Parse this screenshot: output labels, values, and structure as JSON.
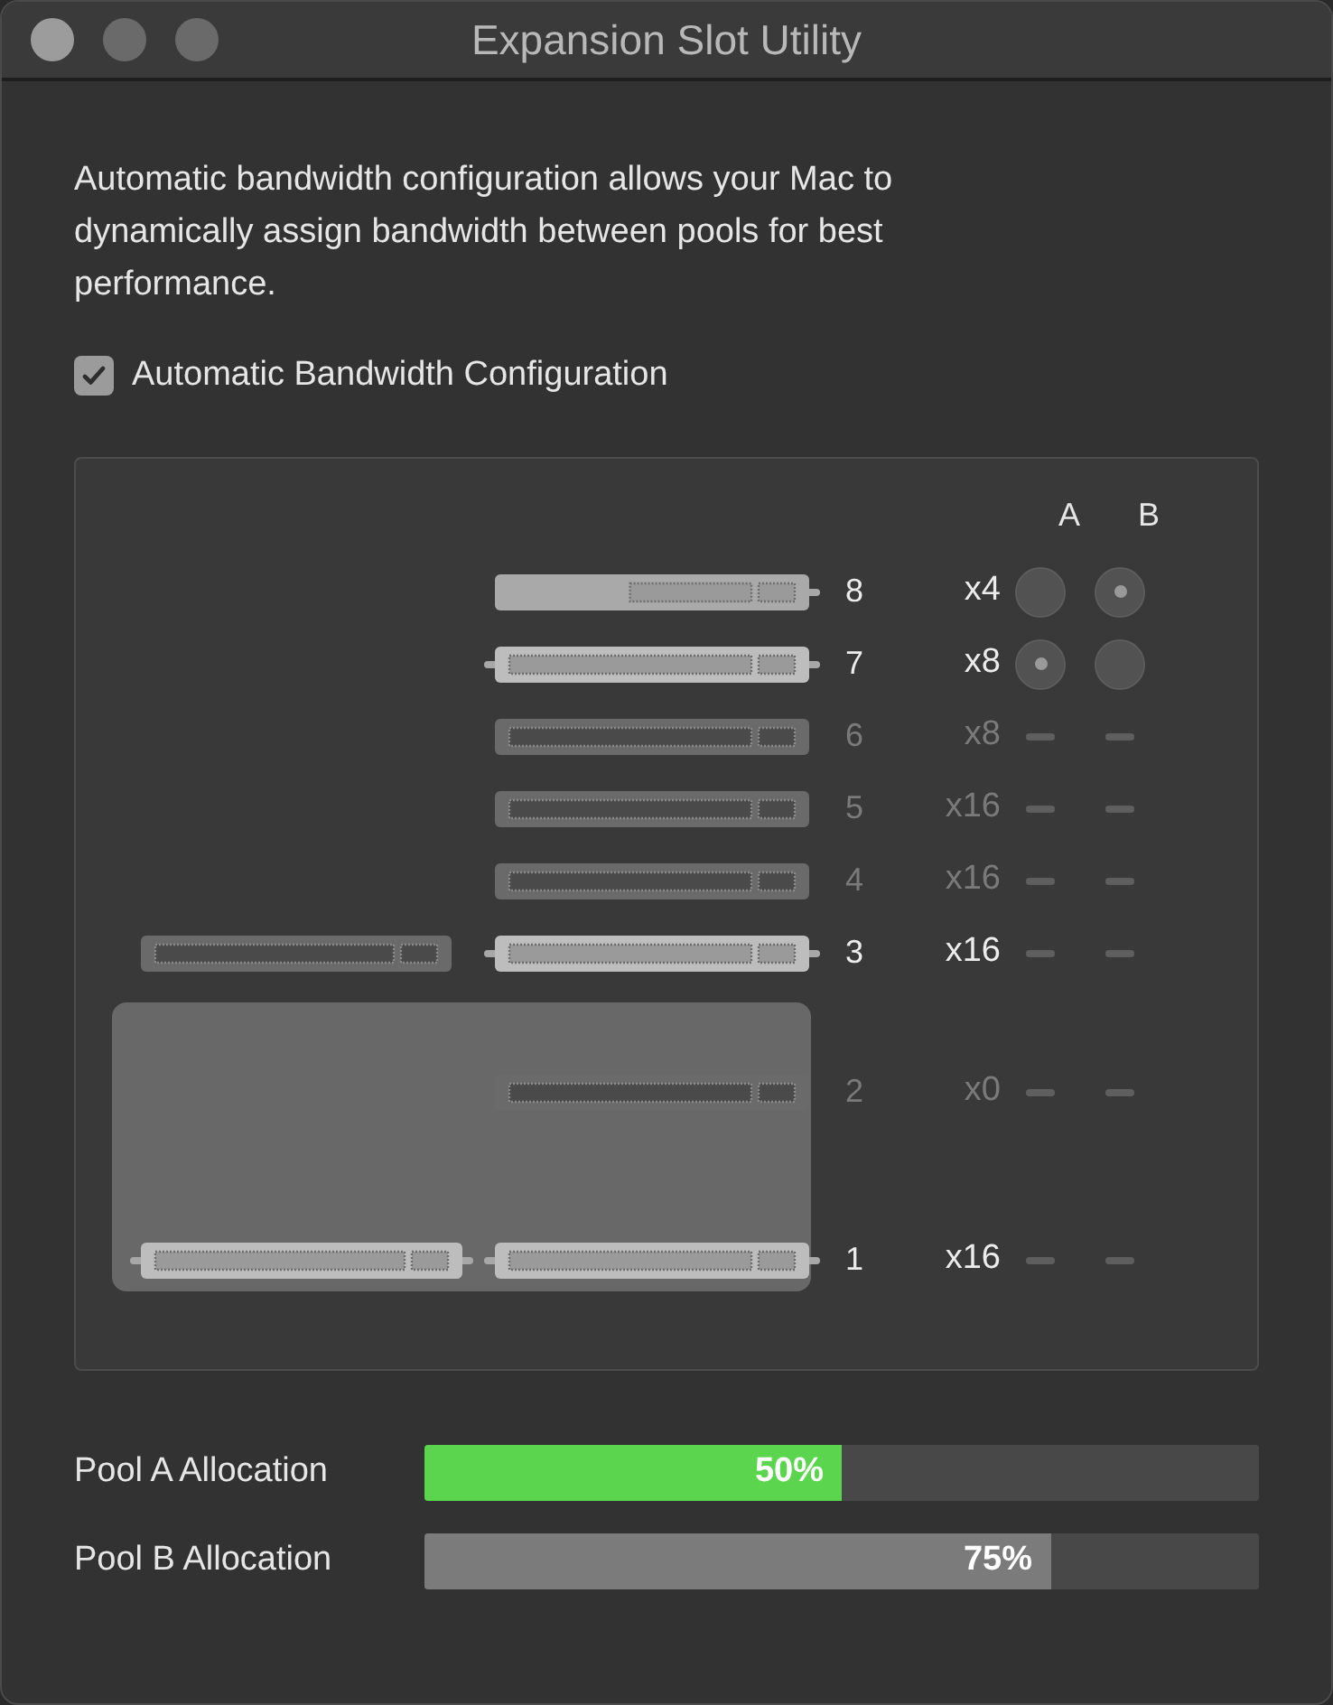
{
  "window": {
    "title": "Expansion Slot Utility"
  },
  "description": "Automatic bandwidth configuration allows your Mac to dynamically assign bandwidth between pools for best performance.",
  "auto_config": {
    "label": "Automatic Bandwidth Configuration",
    "checked": true
  },
  "pool_headers": [
    "A",
    "B"
  ],
  "slots": [
    {
      "number": "8",
      "lanes": "x4",
      "active": true,
      "highlighted": false,
      "connectors": [
        {
          "kind": "short_card"
        }
      ],
      "kind": "radio",
      "pools": [
        {
          "selected": false
        },
        {
          "selected": true
        }
      ]
    },
    {
      "number": "7",
      "lanes": "x8",
      "active": true,
      "highlighted": false,
      "connectors": [
        {
          "kind": "card"
        }
      ],
      "kind": "radio",
      "pools": [
        {
          "selected": true
        },
        {
          "selected": false
        }
      ]
    },
    {
      "number": "6",
      "lanes": "x8",
      "active": false,
      "highlighted": false,
      "connectors": [
        {
          "kind": "empty"
        }
      ],
      "kind": "dash"
    },
    {
      "number": "5",
      "lanes": "x16",
      "active": false,
      "highlighted": false,
      "connectors": [
        {
          "kind": "empty"
        }
      ],
      "kind": "dash"
    },
    {
      "number": "4",
      "lanes": "x16",
      "active": false,
      "highlighted": false,
      "connectors": [
        {
          "kind": "empty"
        }
      ],
      "kind": "dash"
    },
    {
      "number": "3",
      "lanes": "x16",
      "active": true,
      "highlighted": false,
      "connectors": [
        {
          "kind": "empty"
        },
        {
          "kind": "card"
        }
      ],
      "kind": "dash"
    },
    {
      "number": "2",
      "lanes": "x0",
      "active": false,
      "highlighted": true,
      "connectors": [
        {
          "kind": "empty"
        }
      ],
      "kind": "dash"
    },
    {
      "number": "1",
      "lanes": "x16",
      "active": true,
      "highlighted": true,
      "connectors": [
        {
          "kind": "card"
        },
        {
          "kind": "card"
        }
      ],
      "kind": "dash"
    }
  ],
  "allocations": [
    {
      "label": "Pool A Allocation",
      "level": 0.5,
      "reading": "50%",
      "color": "#5ad54d"
    },
    {
      "label": "Pool B Allocation",
      "level": 0.75,
      "reading": "75%",
      "color": "#7b7b7b"
    }
  ]
}
